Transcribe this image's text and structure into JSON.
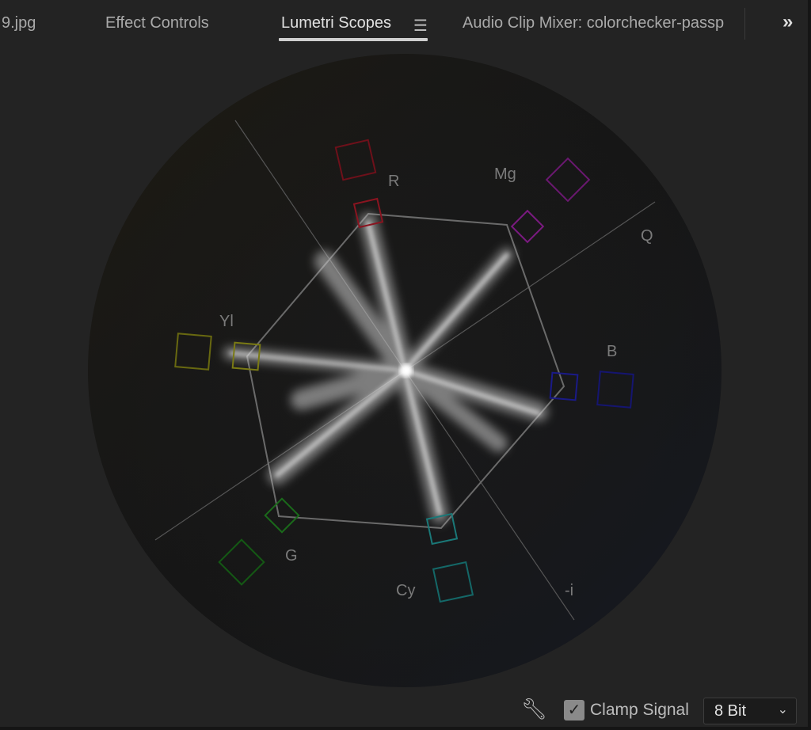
{
  "tabs": [
    {
      "label": "9.jpg",
      "active": false
    },
    {
      "label": "Effect Controls",
      "active": false
    },
    {
      "label": "Lumetri Scopes",
      "active": true
    },
    {
      "label": "Audio Clip Mixer: colorchecker-passp",
      "active": false
    }
  ],
  "tab_menu_icon": "hamburger-menu-icon",
  "overflow_icon": "double-chevron-right-icon",
  "vectorscope": {
    "targets": [
      "R",
      "Mg",
      "B",
      "Cy",
      "G",
      "Yl"
    ],
    "axis_labels": {
      "q": "Q",
      "i": "-i"
    },
    "target_colors": {
      "R": "#8a1420",
      "Mg": "#7a1a80",
      "B": "#1a1a80",
      "Cy": "#1a7878",
      "G": "#1a6a1a",
      "Yl": "#7a7a14"
    }
  },
  "footer": {
    "settings_icon": "wrench-icon",
    "clamp_signal_label": "Clamp Signal",
    "clamp_signal_checked": true,
    "bit_depth": "8 Bit"
  }
}
